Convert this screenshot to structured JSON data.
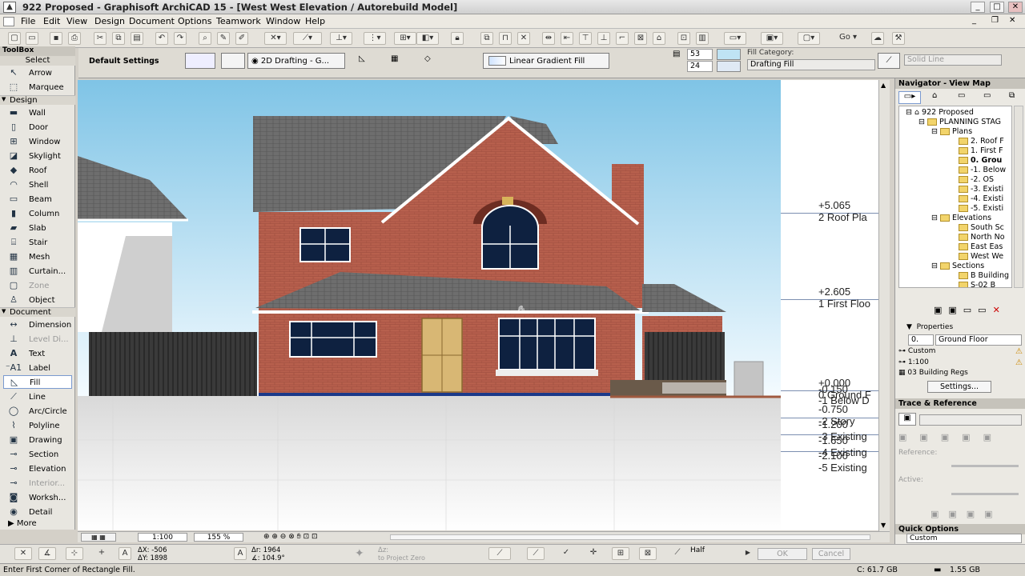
{
  "window": {
    "title": "922 Proposed - Graphisoft ArchiCAD 15 - [West West Elevation / Autorebuild Model]"
  },
  "menu": [
    "File",
    "Edit",
    "View",
    "Design",
    "Document",
    "Options",
    "Teamwork",
    "Window",
    "Help"
  ],
  "infobox": {
    "default_settings": "Default Settings",
    "layer": "2D Drafting - G...",
    "fill_type": "Linear Gradient Fill",
    "pen1": "53",
    "pen2": "24",
    "fill_category_label": "Fill Category:",
    "fill_category_value": "Drafting Fill",
    "line_type": "Solid Line"
  },
  "toolbox": {
    "title": "ToolBox",
    "select": "Select",
    "sections": {
      "design": "Design",
      "document": "Document",
      "more": "More"
    },
    "tools_top": [
      {
        "label": "Arrow"
      },
      {
        "label": "Marquee"
      }
    ],
    "design_tools": [
      {
        "label": "Wall"
      },
      {
        "label": "Door"
      },
      {
        "label": "Window"
      },
      {
        "label": "Skylight"
      },
      {
        "label": "Roof"
      },
      {
        "label": "Shell"
      },
      {
        "label": "Beam"
      },
      {
        "label": "Column"
      },
      {
        "label": "Slab"
      },
      {
        "label": "Stair"
      },
      {
        "label": "Mesh"
      },
      {
        "label": "Curtain..."
      },
      {
        "label": "Zone"
      },
      {
        "label": "Object"
      }
    ],
    "document_tools": [
      {
        "label": "Dimension"
      },
      {
        "label": "Level Di..."
      },
      {
        "label": "Text"
      },
      {
        "label": "Label"
      },
      {
        "label": "Fill"
      },
      {
        "label": "Line"
      },
      {
        "label": "Arc/Circle"
      },
      {
        "label": "Polyline"
      },
      {
        "label": "Drawing"
      },
      {
        "label": "Section"
      },
      {
        "label": "Elevation"
      },
      {
        "label": "Interior..."
      },
      {
        "label": "Worksh..."
      },
      {
        "label": "Detail"
      }
    ]
  },
  "elevations": [
    {
      "value": "+5.065",
      "name": "2 Roof Pla"
    },
    {
      "value": "+2.605",
      "name": "1 First Floo"
    },
    {
      "value": "+0.000",
      "name": "0 Ground F"
    },
    {
      "value": "-0.150",
      "name": "-1 Below D"
    },
    {
      "value": "-0.750",
      "name": "-2 Story"
    },
    {
      "value": "-1.200",
      "name": "-3 Existing"
    },
    {
      "value": "-1.650",
      "name": "-4 Existing"
    },
    {
      "value": "-2.100",
      "name": "-5 Existing"
    }
  ],
  "bottombar": {
    "scale": "1:100",
    "zoom": "155 %"
  },
  "controlbox": {
    "dx": "ΔX: -506",
    "dy": "ΔY: 1898",
    "dr": "Δr: 1964",
    "angle": "∡: 104.9°",
    "dz": "Δz:",
    "to_zero": "to Project Zero",
    "snap": "Half",
    "ok": "OK",
    "cancel": "Cancel"
  },
  "status": {
    "message": "Enter First Corner of Rectangle Fill.",
    "disk_c": "C: 61.7 GB",
    "ram": "1.55 GB"
  },
  "navigator": {
    "title": "Navigator - View Map",
    "tree": [
      "922 Proposed",
      "PLANNING STAG",
      "Plans",
      "2. Roof F",
      "1. First F",
      "0. Grou",
      "-1. Below",
      "-2. OS",
      "-3. Existi",
      "-4. Existi",
      "-5. Existi",
      "Elevations",
      "South Sc",
      "North No",
      "East Eas",
      "West We",
      "Sections",
      "B Building",
      "S-02 B"
    ],
    "properties_title": "Properties",
    "prop_id": "0.",
    "prop_name": "Ground Floor",
    "prop_custom": "Custom",
    "prop_scale": "1:100",
    "prop_set": "03 Building Regs",
    "settings_btn": "Settings..."
  },
  "trace": {
    "title": "Trace & Reference",
    "reference": "Reference:",
    "active": "Active:"
  },
  "quickoptions": {
    "title": "Quick Options",
    "value": "Custom"
  }
}
